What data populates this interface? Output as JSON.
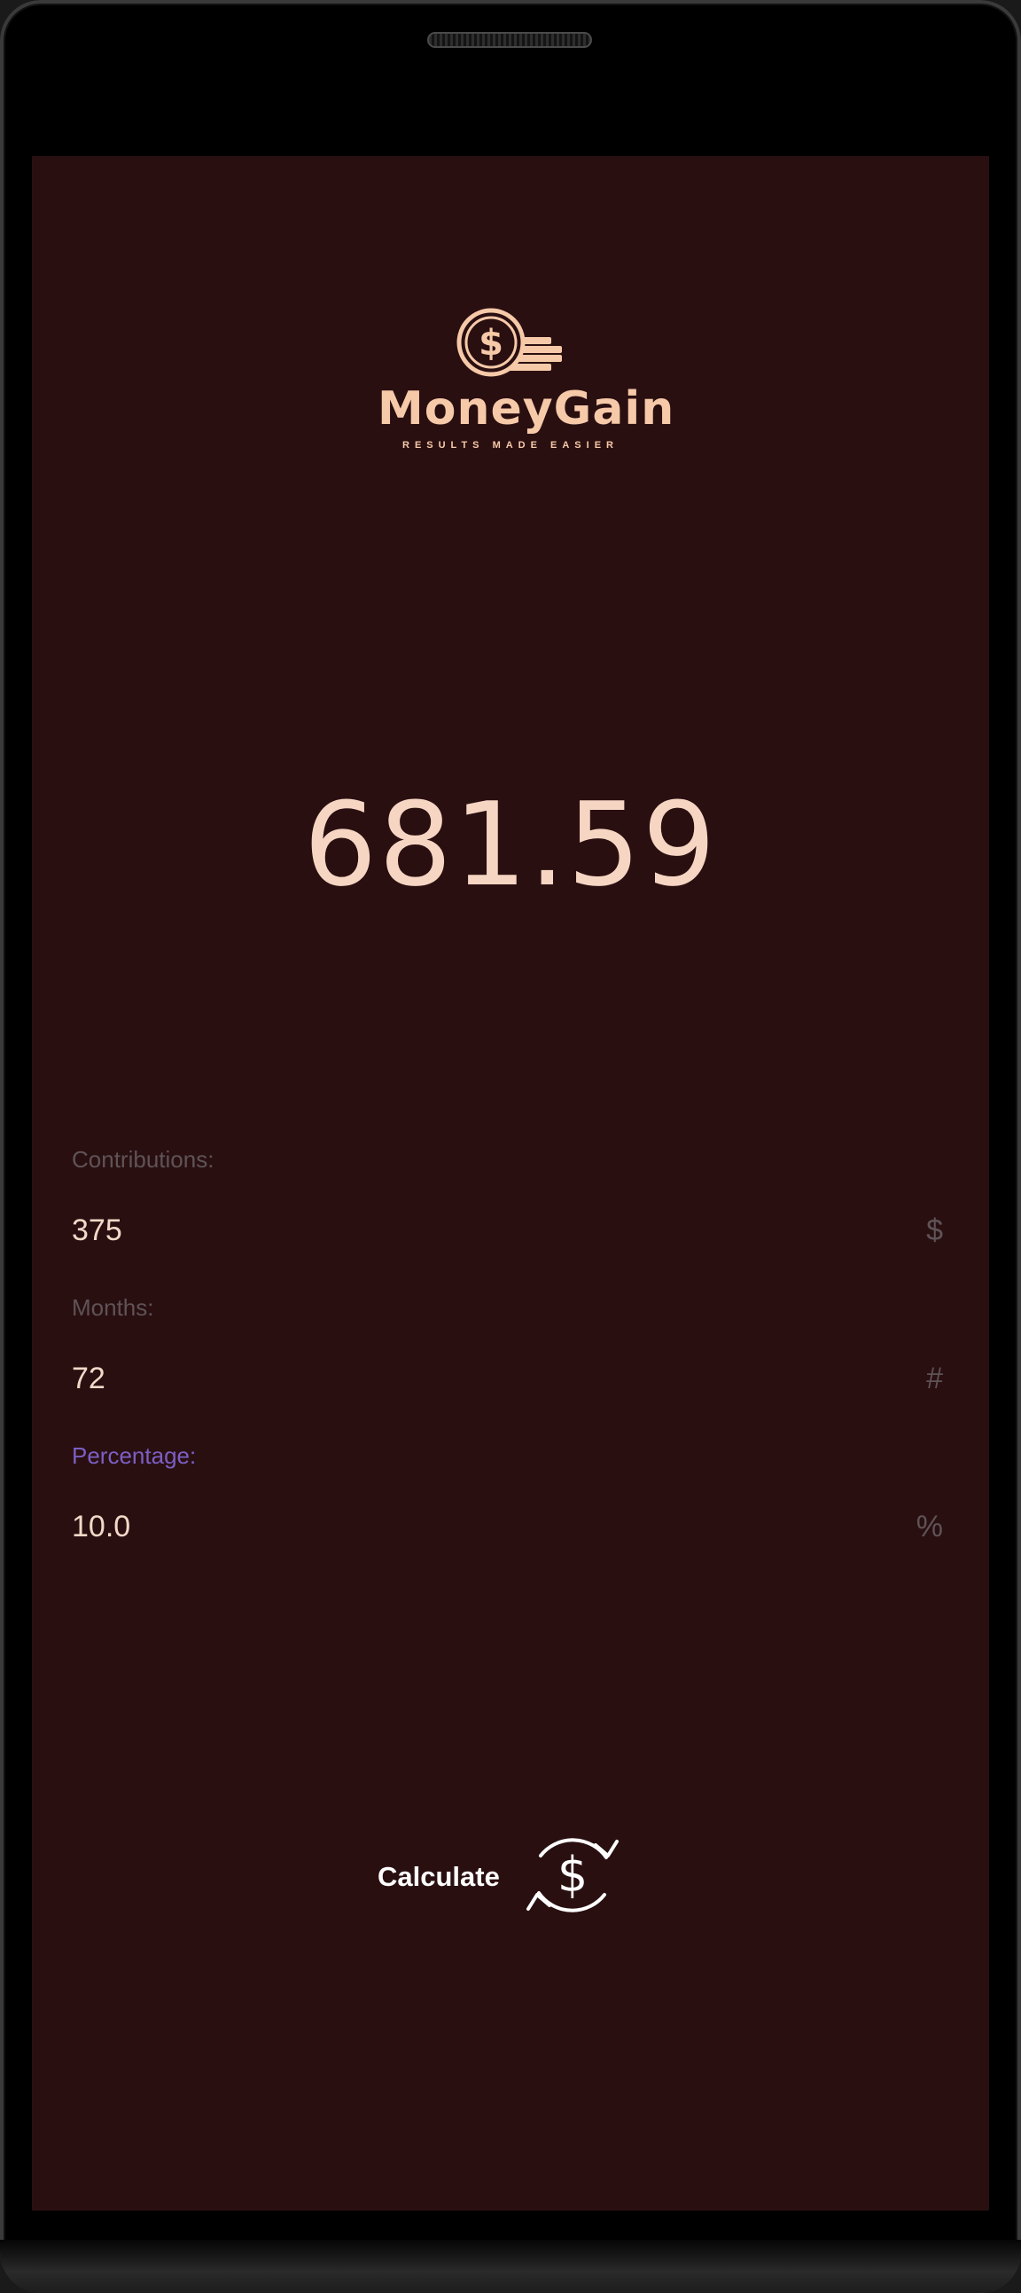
{
  "app": {
    "brand_name": "MoneyGain",
    "tagline": "RESULTS MADE EASIER",
    "logo_icon": "dollar-coin-stack-icon"
  },
  "result": {
    "value": "681.59"
  },
  "fields": [
    {
      "label": "Contributions:",
      "value": "375",
      "suffix": "$",
      "focused": false
    },
    {
      "label": "Months:",
      "value": "72",
      "suffix": "#",
      "focused": false
    },
    {
      "label": "Percentage:",
      "value": "10.0",
      "suffix": "%",
      "focused": true
    }
  ],
  "actions": {
    "calculate_label": "Calculate",
    "calculate_icon": "dollar-refresh-icon"
  },
  "colors": {
    "background": "#2a0f11",
    "accent": "#f6c9a8",
    "focus_label": "#7b5fc4"
  }
}
